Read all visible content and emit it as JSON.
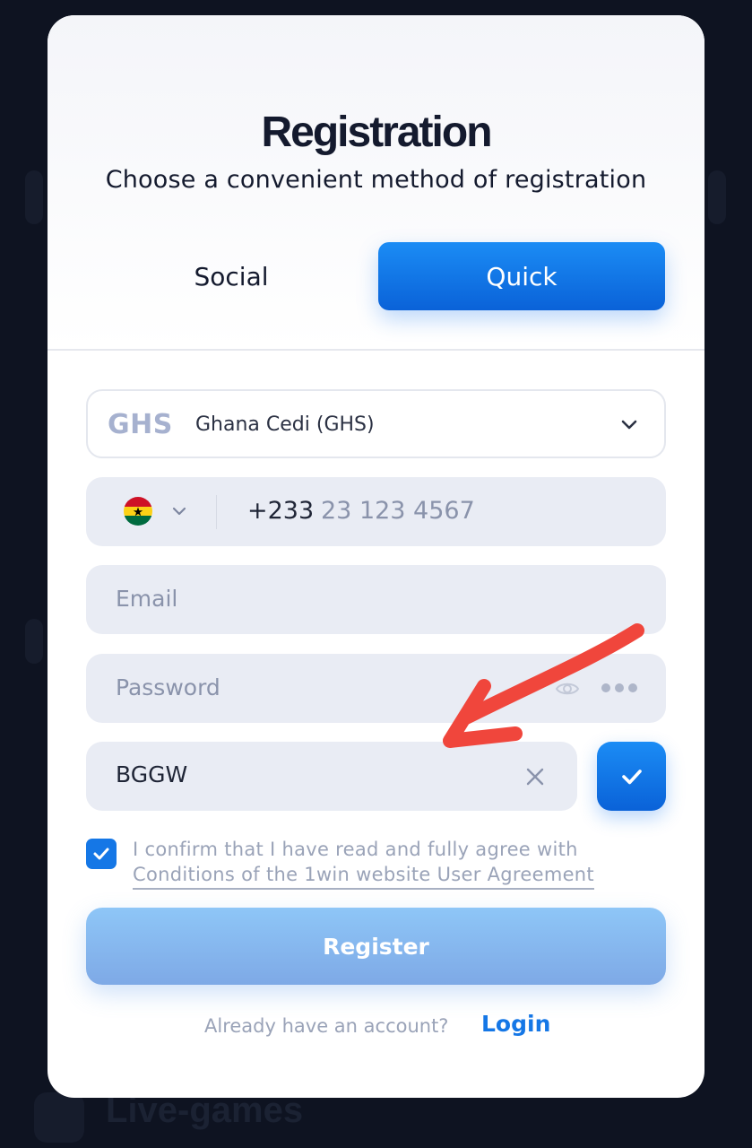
{
  "background": {
    "ghost_label": "Live-games",
    "color": "#0e1321"
  },
  "modal": {
    "title": "Registration",
    "subtitle": "Choose a convenient method of registration",
    "tabs": [
      {
        "label": "Social",
        "active": false
      },
      {
        "label": "Quick",
        "active": true
      }
    ],
    "accent_color": "#1577e6"
  },
  "form": {
    "currency": {
      "code": "GHS",
      "name": "Ghana Cedi (GHS)",
      "icon": "chevron-down-icon"
    },
    "phone": {
      "country_flag": "ghana-flag-icon",
      "dial_code": "+233",
      "placeholder": "23 123 4567"
    },
    "email": {
      "placeholder": "Email",
      "value": ""
    },
    "password": {
      "placeholder": "Password",
      "value": "",
      "icons": [
        "eye-icon",
        "more-dots-icon"
      ]
    },
    "promo_code": {
      "value": "BGGW",
      "clear_icon": "close-icon",
      "confirm_icon": "checkmark-icon"
    },
    "agreement": {
      "checked": true,
      "line1": "I confirm that I have read and fully agree with",
      "line2": "Conditions of the 1win website User Agreement"
    },
    "register_label": "Register"
  },
  "footer": {
    "already_text": "Already have an account?",
    "login_label": "Login"
  },
  "annotation": {
    "type": "red-arrow",
    "color": "#f0463c",
    "points_to": "promo_code"
  }
}
